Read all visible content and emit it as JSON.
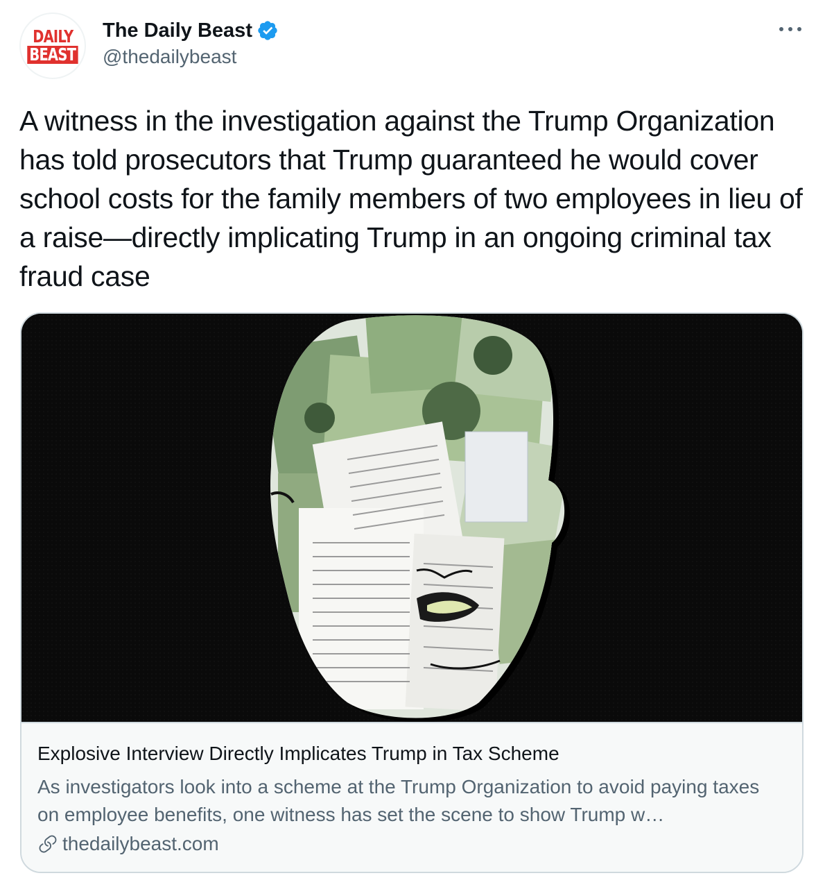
{
  "author": {
    "avatar_line1": "DAILY",
    "avatar_line2": "BEAST",
    "display_name": "The Daily Beast",
    "handle": "@thedailybeast",
    "verified": true
  },
  "tweet": {
    "text": "A witness in the investigation against the Trump Organization has told prosecutors that Trump guaranteed he would cover school costs for the family members of two employees in lieu of a raise—directly implicating Trump in an ongoing criminal tax fraud case"
  },
  "card": {
    "image_icon": "money-collage-face-illustration",
    "title": "Explosive Interview Directly Implicates Trump in Tax Scheme",
    "description": "As investigators look into a scheme at the Trump Organization to avoid paying taxes on employee benefits, one witness has set the scene to show Trump w…",
    "domain": "thedailybeast.com"
  },
  "colors": {
    "text_primary": "#0f1419",
    "text_secondary": "#536471",
    "border": "#cfd9de",
    "verified_blue": "#1d9bf0",
    "brand_red": "#e0312e"
  }
}
